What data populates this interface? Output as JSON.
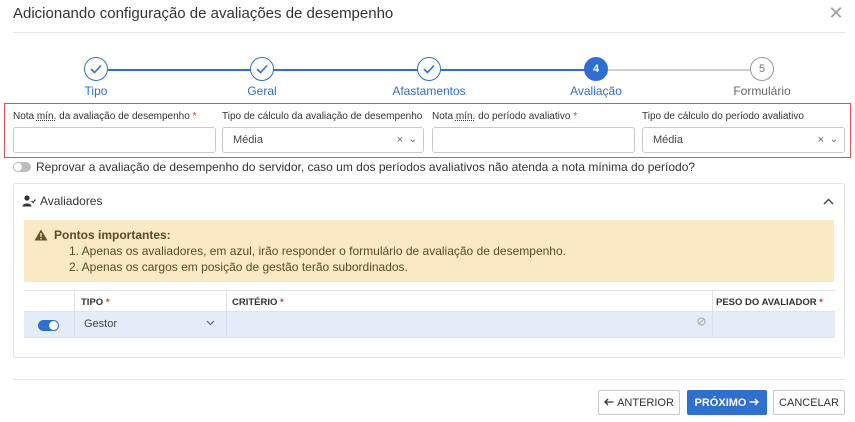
{
  "modal": {
    "title": "Adicionando configuração de avaliações de desempenho",
    "close_glyph": "✕"
  },
  "stepper": {
    "steps": [
      {
        "label": "Tipo",
        "state": "done",
        "mark": ""
      },
      {
        "label": "Geral",
        "state": "done",
        "mark": ""
      },
      {
        "label": "Afastamentos",
        "state": "done",
        "mark": ""
      },
      {
        "label": "Avaliação",
        "state": "active",
        "mark": "4"
      },
      {
        "label": "Formulário",
        "state": "todo",
        "mark": "5"
      }
    ]
  },
  "fields": {
    "nota_min_avaliacao": {
      "label_pre": "Nota ",
      "label_abbr": "mín.",
      "label_post": " da avaliação de desempenho",
      "required": "*",
      "value": ""
    },
    "tipo_calculo_avaliacao": {
      "label": "Tipo de cálculo da avaliação de desempenho",
      "value": "Média",
      "clear": "×",
      "chevron": "⌄"
    },
    "nota_min_periodo": {
      "label_pre": "Nota ",
      "label_abbr": "mín.",
      "label_post": " do período avaliativo",
      "required": "*",
      "value": ""
    },
    "tipo_calculo_periodo": {
      "label": "Tipo de cálculo do período avaliativo",
      "value": "Média",
      "clear": "×",
      "chevron": "⌄"
    }
  },
  "reprovar": {
    "label": "Reprovar a avaliação de desempenho do servidor, caso um dos períodos avaliativos não atenda a nota mínima do período?",
    "enabled": false
  },
  "avaliadores": {
    "title": "Avaliadores",
    "warning": {
      "title": "Pontos importantes:",
      "lines": [
        "1. Apenas os avaliadores, em azul, irão responder o formulário de avaliação de desempenho.",
        "2. Apenas os cargos em posição de gestão terão subordinados."
      ]
    },
    "table": {
      "headers": {
        "tipo": "TIPO",
        "criterio": "CRITÉRIO",
        "peso": "PESO DO AVALIADOR",
        "required": "*"
      },
      "rows": [
        {
          "enabled": true,
          "tipo": "Gestor",
          "criterio": "",
          "peso": ""
        }
      ]
    }
  },
  "footer": {
    "anterior": "ANTERIOR",
    "proximo": "PRÓXIMO",
    "cancelar": "CANCELAR"
  },
  "colors": {
    "accent": "#2f6fce",
    "warning_bg": "#fbe8c4",
    "highlight_border": "#d9534f",
    "required": "#d9342b",
    "row_selected": "#e4ecf9"
  }
}
